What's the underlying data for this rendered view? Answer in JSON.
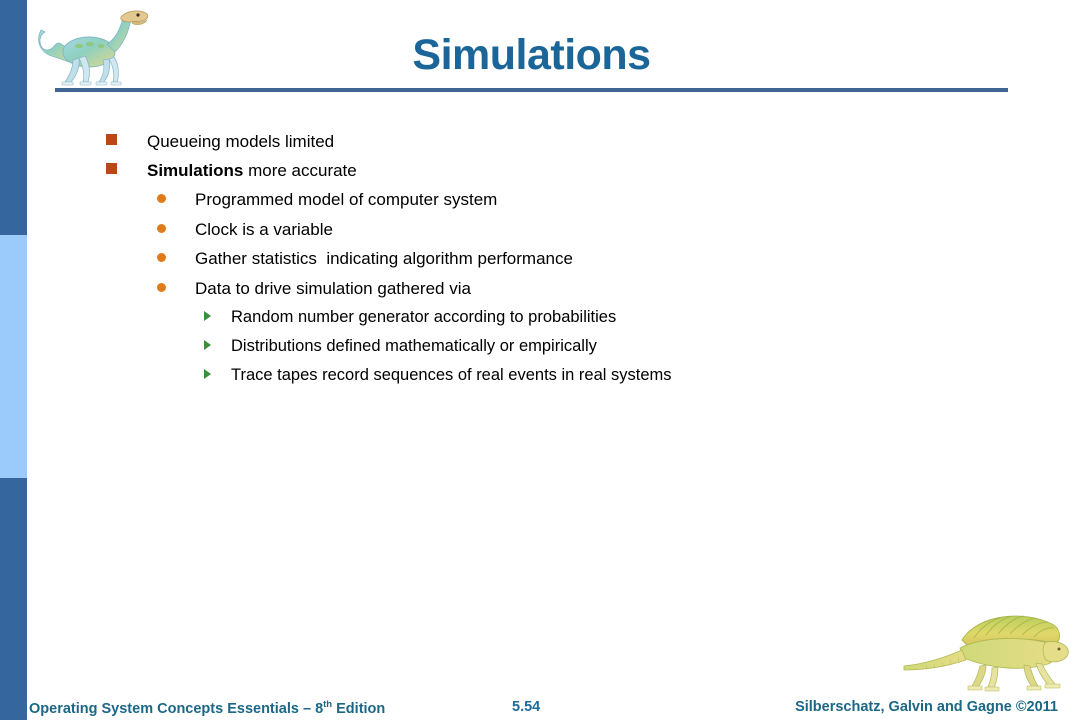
{
  "slide": {
    "title": "Simulations",
    "page_number": "5.54"
  },
  "decor": {
    "sidebar_dark_color": "#35679e",
    "sidebar_light_color": "#9bcbfb",
    "title_color": "#1b6699",
    "rule_color": "#3f6592",
    "bullet_l1_color": "#bb4718",
    "bullet_l2_color": "#e07b1c",
    "bullet_l3_color": "#3c8d3c",
    "top_dino_icon": "dinosaur-illustration",
    "bottom_dino_icon": "dimetrodon-illustration"
  },
  "content": [
    {
      "level": 1,
      "text": "Queueing models limited",
      "bold_prefix": ""
    },
    {
      "level": 1,
      "text": " more accurate",
      "bold_prefix": "Simulations"
    },
    {
      "level": 2,
      "text": "Programmed model of computer system"
    },
    {
      "level": 2,
      "text": "Clock is a variable"
    },
    {
      "level": 2,
      "text": "Gather statistics  indicating algorithm performance"
    },
    {
      "level": 2,
      "text": "Data to drive simulation gathered via"
    },
    {
      "level": 3,
      "text": "Random number generator according to probabilities"
    },
    {
      "level": 3,
      "text": "Distributions defined mathematically or empirically"
    },
    {
      "level": 3,
      "text": "Trace tapes record sequences of real events in real systems"
    }
  ],
  "footer": {
    "book_prefix": "Operating System Concepts Essentials – 8",
    "book_sup": "th",
    "book_suffix": " Edition",
    "copyright": "Silberschatz, Galvin and Gagne ©2011"
  }
}
